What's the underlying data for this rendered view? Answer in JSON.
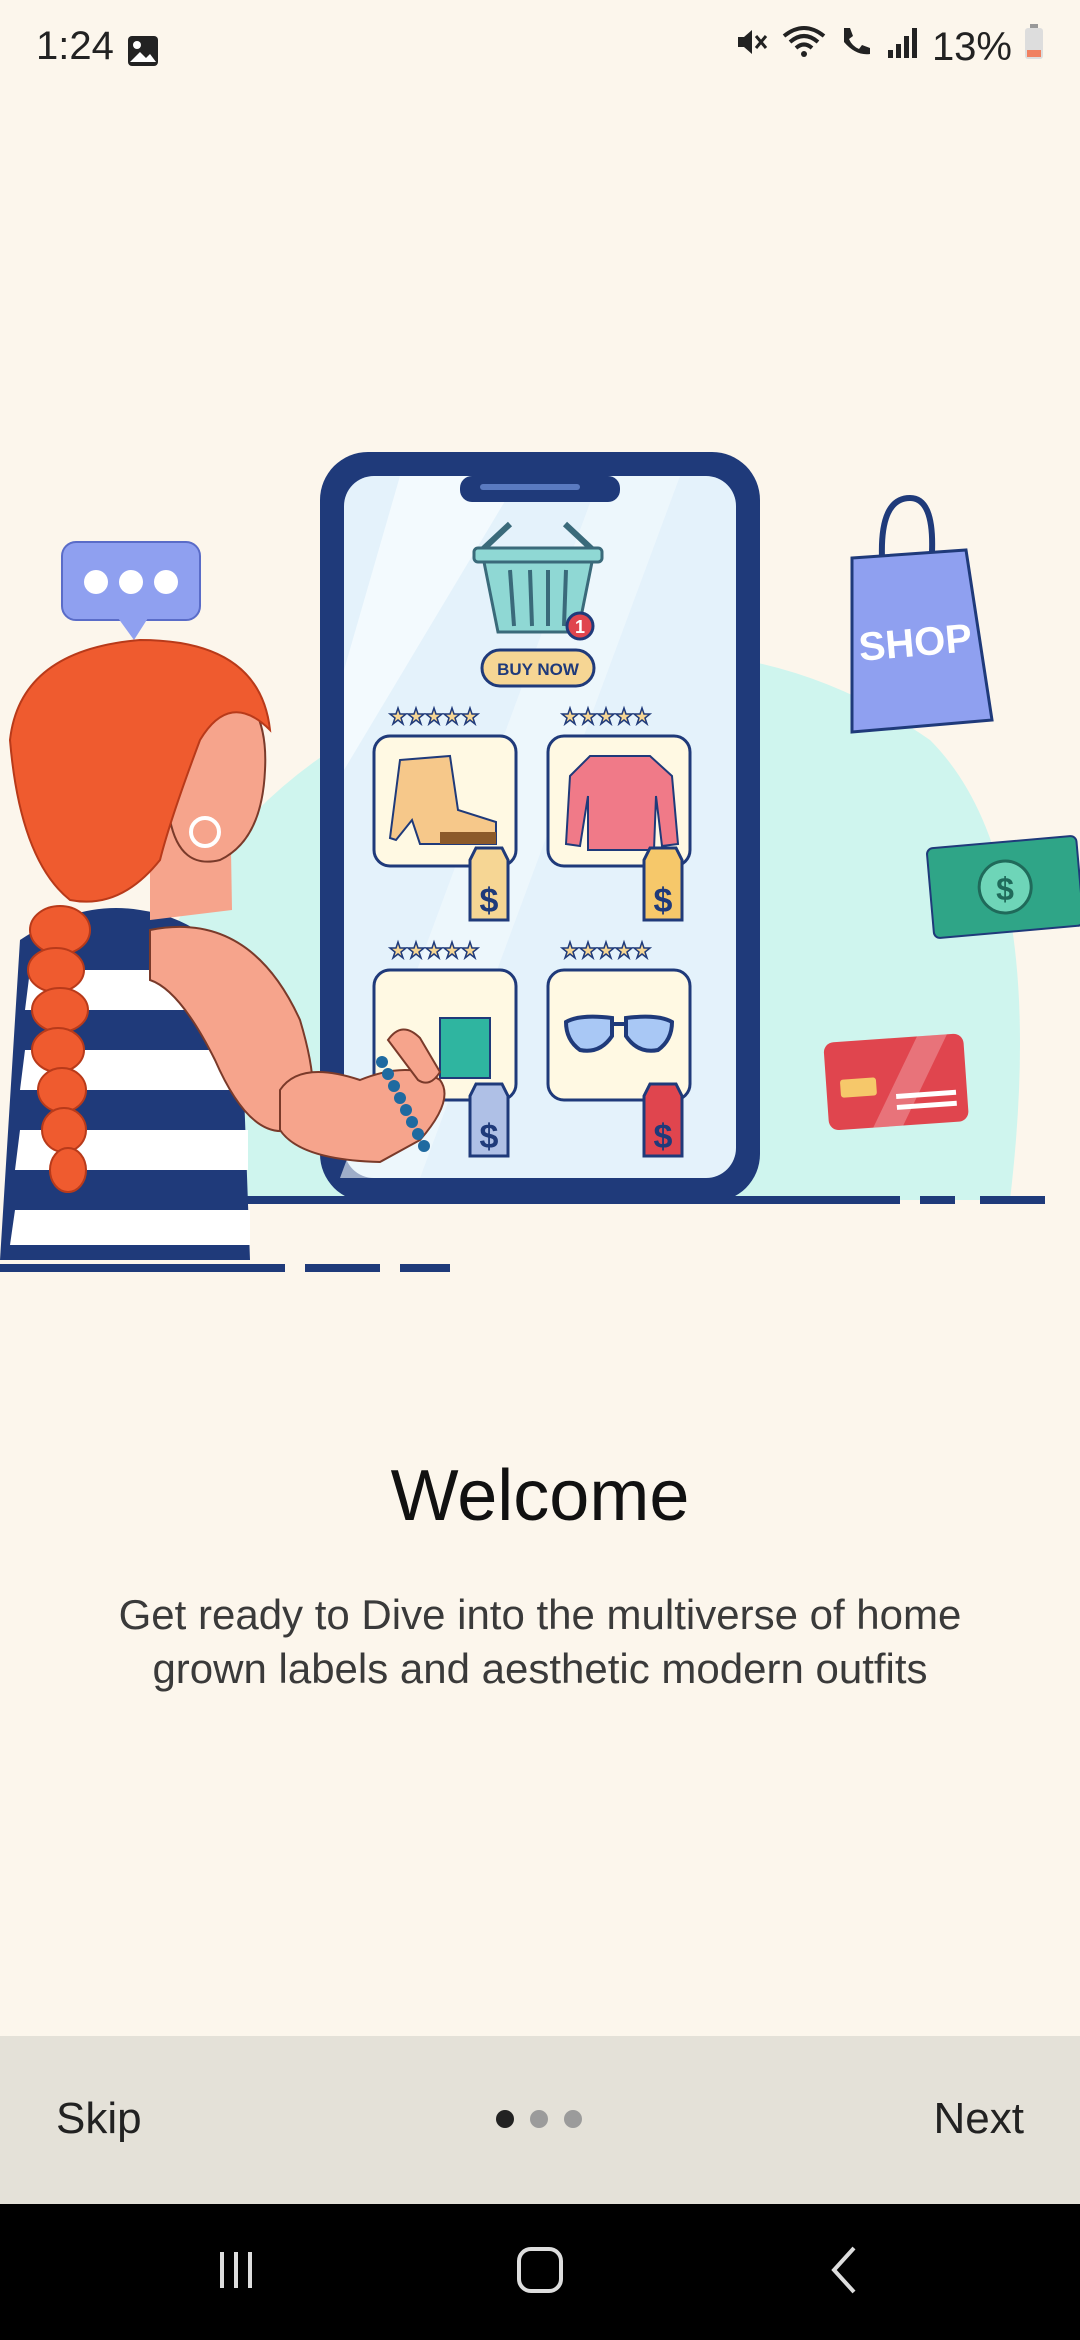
{
  "status_bar": {
    "time": "1:24",
    "battery": "13%",
    "icons": [
      "image-icon",
      "mute-icon",
      "wifi-icon",
      "wifi-calling-icon",
      "signal-icon",
      "battery-icon"
    ]
  },
  "onboarding": {
    "title": "Welcome",
    "description": "Get ready to Dive into the multiverse of home grown labels and aesthetic modern outfits",
    "illustration": {
      "button_text": "BUY NOW",
      "bag_text": "SHOP",
      "cart_badge": "1",
      "price_symbol": "$"
    }
  },
  "footer": {
    "skip_label": "Skip",
    "next_label": "Next",
    "page_count": 3,
    "current_page": 1
  },
  "nav_bar": {
    "buttons": [
      "recents-icon",
      "home-icon",
      "back-icon"
    ]
  },
  "colors": {
    "background": "#FCF6EC",
    "footer_bg": "#E4E1D8",
    "phone_frame": "#1F3A7A",
    "accent_orange": "#EF5B2F",
    "bag_purple": "#8FA0F0"
  }
}
